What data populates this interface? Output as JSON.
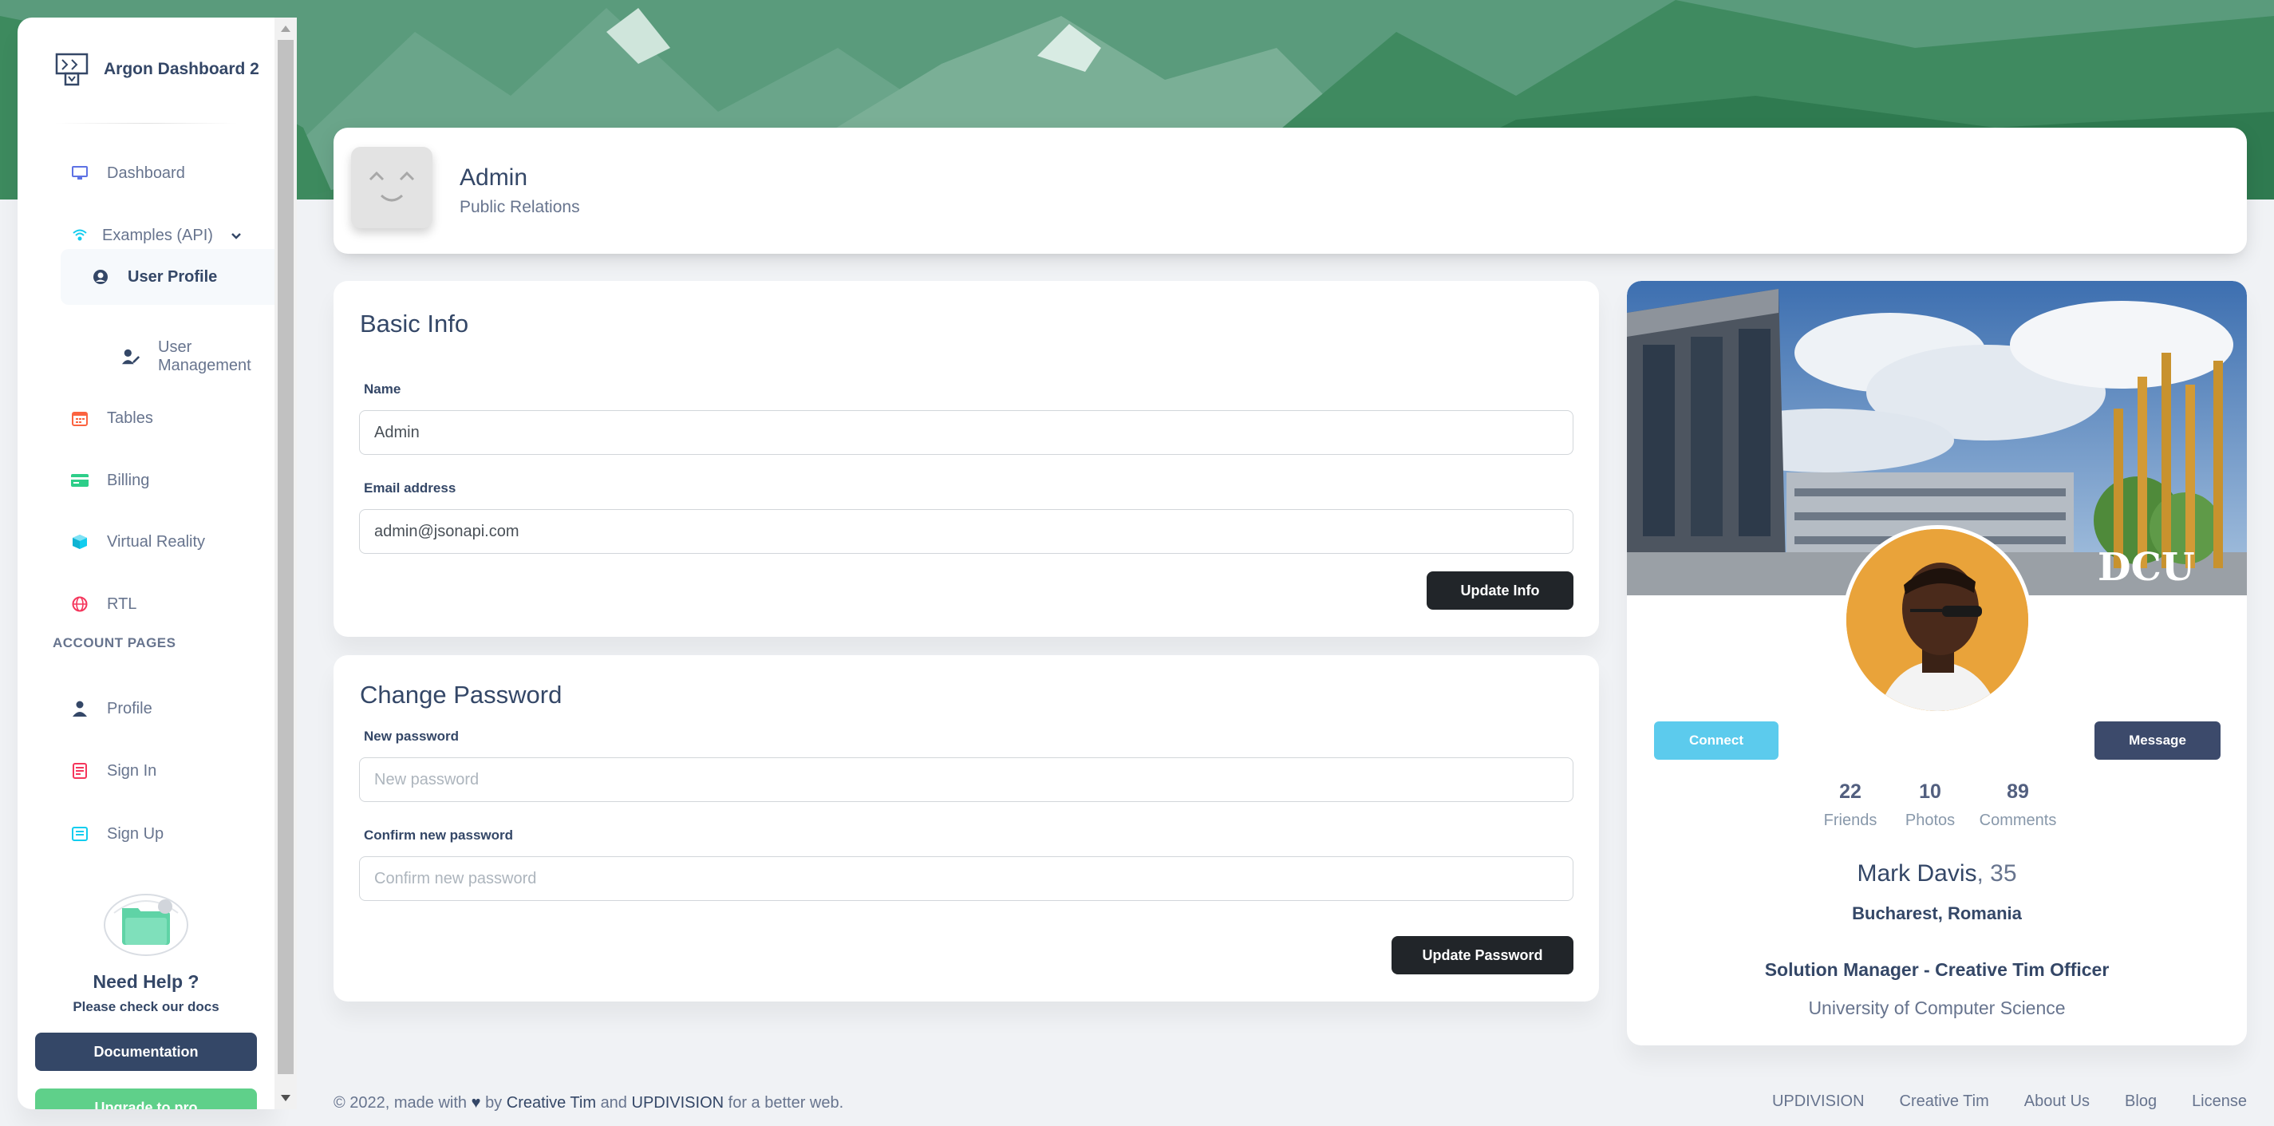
{
  "brand": {
    "title": "Argon Dashboard 2"
  },
  "sidebar": {
    "items": [
      {
        "label": "Dashboard"
      },
      {
        "label": "Examples (API)"
      },
      {
        "label": "User Profile"
      },
      {
        "label": "User Management"
      },
      {
        "label": "Tables"
      },
      {
        "label": "Billing"
      },
      {
        "label": "Virtual Reality"
      },
      {
        "label": "RTL"
      }
    ],
    "section_title": "ACCOUNT PAGES",
    "account_items": [
      {
        "label": "Profile"
      },
      {
        "label": "Sign In"
      },
      {
        "label": "Sign Up"
      }
    ],
    "help": {
      "title": "Need Help ?",
      "subtitle": "Please check our docs"
    },
    "documentation_label": "Documentation",
    "upgrade_label": "Upgrade to pro"
  },
  "header": {
    "name": "Admin",
    "role": "Public Relations"
  },
  "basic_info": {
    "title": "Basic Info",
    "name_label": "Name",
    "name_value": "Admin",
    "email_label": "Email address",
    "email_value": "admin@jsonapi.com",
    "submit_label": "Update Info"
  },
  "change_password": {
    "title": "Change Password",
    "new_label": "New password",
    "new_placeholder": "New password",
    "confirm_label": "Confirm new password",
    "confirm_placeholder": "Confirm new password",
    "submit_label": "Update Password"
  },
  "profile": {
    "cover_text": "DCU",
    "connect_label": "Connect",
    "message_label": "Message",
    "stats": [
      {
        "value": "22",
        "label": "Friends"
      },
      {
        "value": "10",
        "label": "Photos"
      },
      {
        "value": "89",
        "label": "Comments"
      }
    ],
    "name": "Mark Davis",
    "age": ", 35",
    "location": "Bucharest, Romania",
    "job": "Solution Manager - Creative Tim Officer",
    "school": "University of Computer Science"
  },
  "footer": {
    "prefix": "© 2022, made with",
    "by": "by",
    "author1": "Creative Tim",
    "and": "and",
    "author2": "UPDIVISION",
    "suffix": "for a better web.",
    "links": [
      "UPDIVISION",
      "Creative Tim",
      "About Us",
      "Blog",
      "License"
    ]
  },
  "colors": {
    "primary": "#344767",
    "text_muted": "#67748e",
    "info": "#5ccbed",
    "dark": "#212529",
    "hero_green": "#4f9374"
  }
}
